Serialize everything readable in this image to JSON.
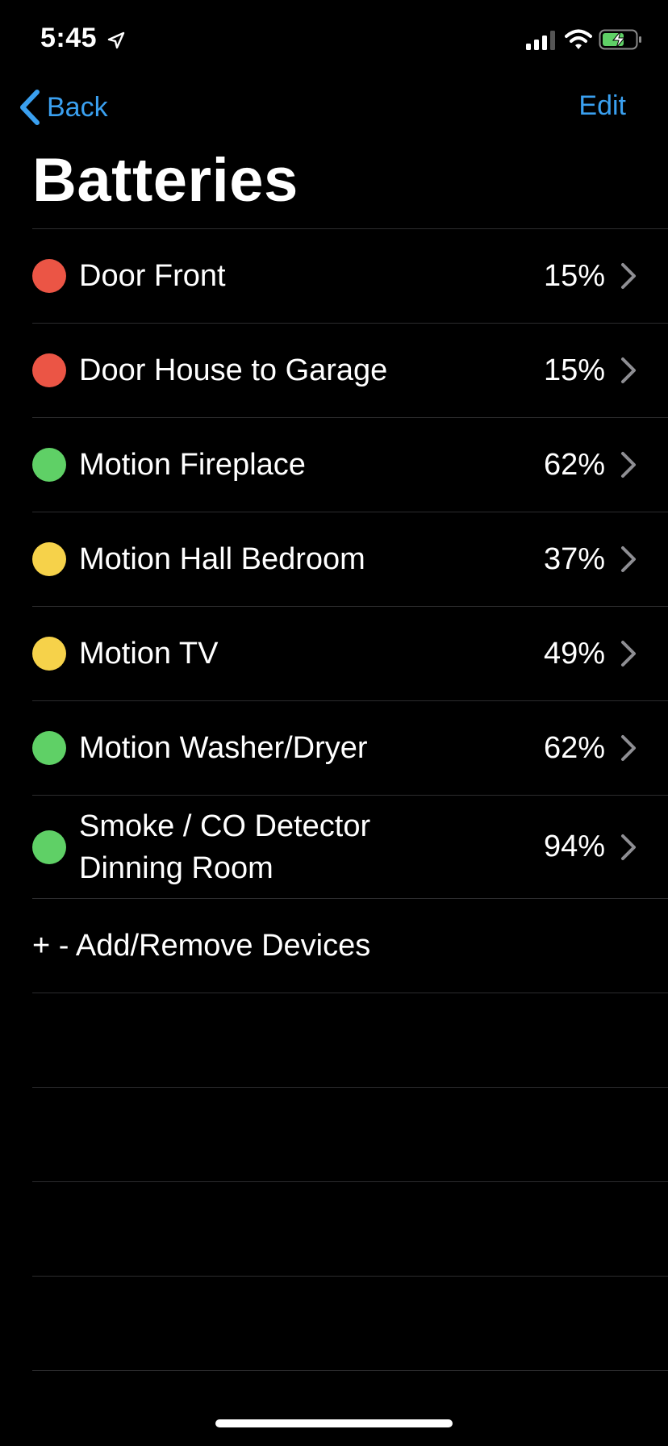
{
  "status_bar": {
    "time": "5:45"
  },
  "nav": {
    "back_label": "Back",
    "edit_label": "Edit"
  },
  "title": "Batteries",
  "colors": {
    "red": "#eb5545",
    "green": "#5fd066",
    "yellow": "#f6d24a",
    "accent": "#3aa0f0"
  },
  "devices": [
    {
      "name": "Door Front",
      "percent": "15%",
      "status": "red"
    },
    {
      "name": "Door House to Garage",
      "percent": "15%",
      "status": "red"
    },
    {
      "name": "Motion Fireplace",
      "percent": "62%",
      "status": "green"
    },
    {
      "name": "Motion Hall Bedroom",
      "percent": "37%",
      "status": "yellow"
    },
    {
      "name": "Motion TV",
      "percent": "49%",
      "status": "yellow"
    },
    {
      "name": "Motion Washer/Dryer",
      "percent": "62%",
      "status": "green"
    },
    {
      "name": "Smoke / CO Detector Dinning Room",
      "percent": "94%",
      "status": "green"
    }
  ],
  "add_remove_label": "+ - Add/Remove Devices"
}
